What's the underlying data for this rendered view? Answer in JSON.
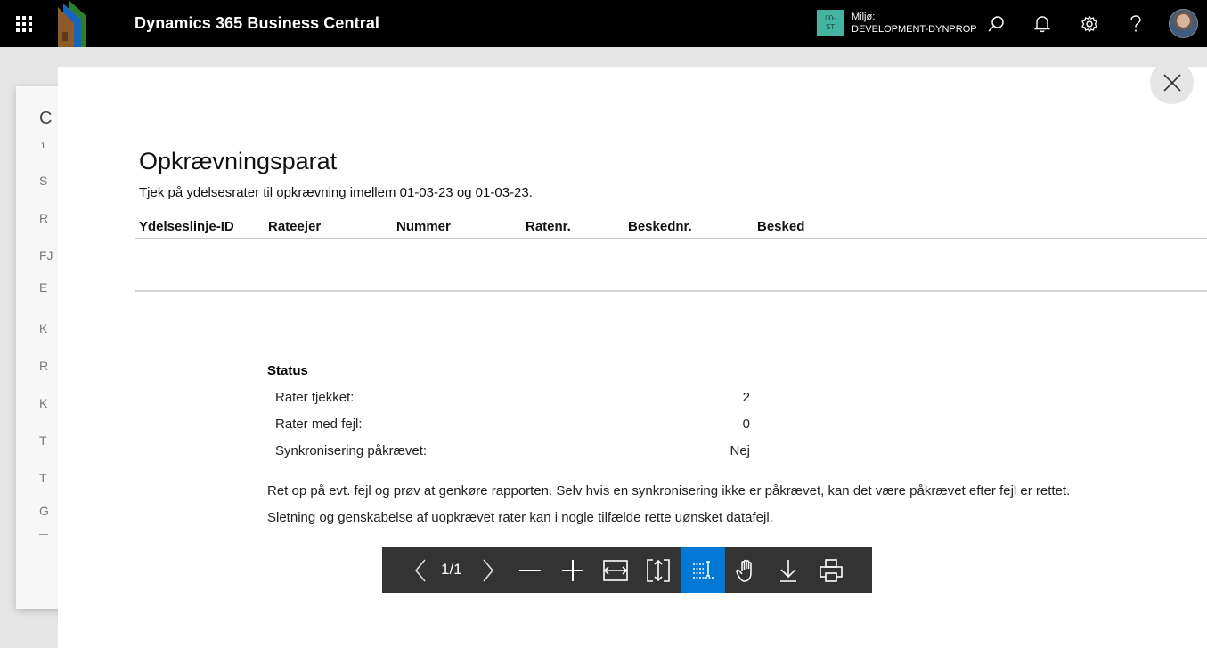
{
  "app": {
    "title": "Dynamics 365 Business Central"
  },
  "environment": {
    "badge_line1": "00-",
    "badge_line2": "ST",
    "label": "Miljø:",
    "name": "DEVELOPMENT-DYNPROP"
  },
  "background_page": {
    "items": [
      "C",
      "J",
      "S",
      "R",
      "FJ",
      "E",
      "K",
      "R",
      "K",
      "T",
      "T",
      "G"
    ]
  },
  "report": {
    "title": "Opkrævningsparat",
    "subtitle": "Tjek på ydelsesrater til opkrævning imellem 01-03-23 og 01-03-23.",
    "columns": [
      "Ydelseslinje-ID",
      "Rateejer",
      "Nummer",
      "Ratenr.",
      "Beskednr.",
      "Besked"
    ],
    "status_heading": "Status",
    "status_rows": [
      {
        "label": "Rater tjekket:",
        "value": "2"
      },
      {
        "label": "Rater med fejl:",
        "value": "0"
      },
      {
        "label": "Synkronisering påkrævet:",
        "value": "Nej"
      }
    ],
    "notes": [
      "Ret op på evt. fejl og prøv at genkøre rapporten. Selv hvis en synkronisering ikke er påkrævet, kan det være påkrævet efter fejl er rettet.",
      "Sletning og genskabelse af uopkrævet rater kan i nogle tilfælde rette uønsket datafejl."
    ]
  },
  "pdf_toolbar": {
    "page_indicator": "1/1",
    "buttons": [
      "previous-page",
      "next-page",
      "zoom-out",
      "zoom-in",
      "fit-width",
      "fit-page",
      "text-select",
      "hand-tool",
      "download",
      "print"
    ],
    "active": "text-select"
  },
  "colors": {
    "accent": "#0078d4",
    "env_badge": "#44b4a1",
    "topbar": "#000000",
    "toolbar": "#333333"
  }
}
